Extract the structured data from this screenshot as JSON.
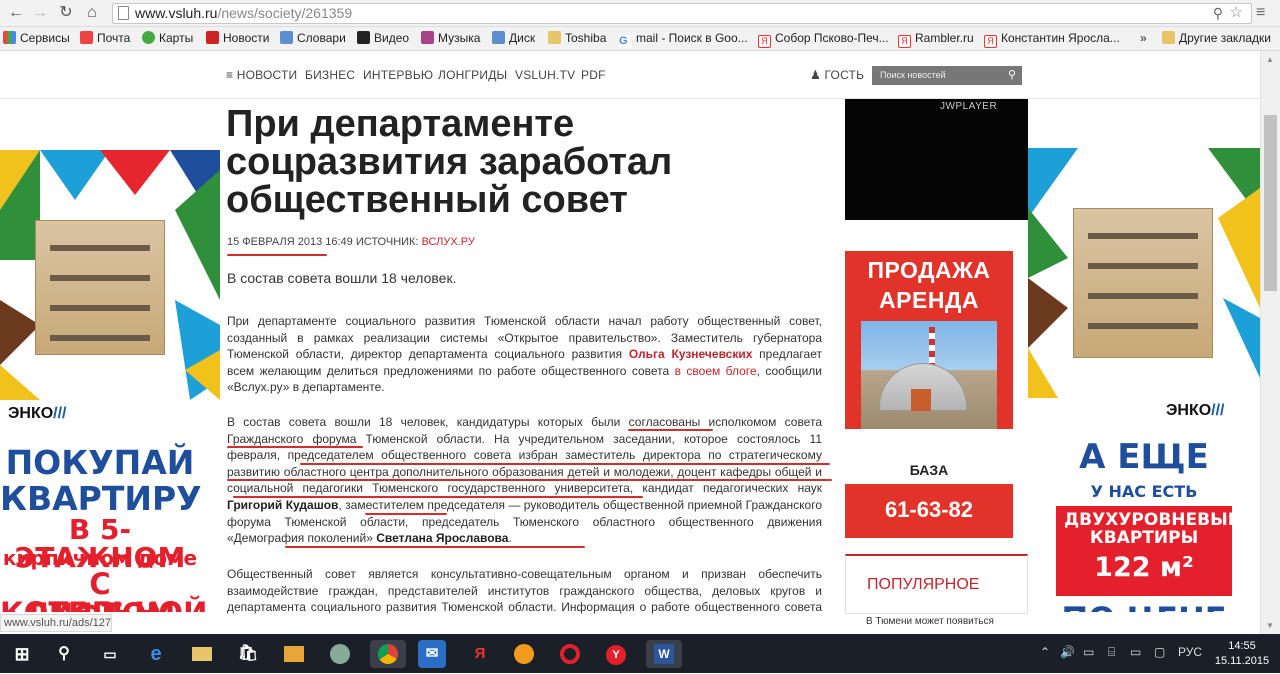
{
  "browser": {
    "url_domain": "www.vsluh.ru",
    "url_path": "/news/society/261359",
    "bookmarks": [
      "Сервисы",
      "Почта",
      "Карты",
      "Новости",
      "Словари",
      "Видео",
      "Музыка",
      "Диск",
      "Toshiba",
      "mail - Поиск в Goo...",
      "Собор Псково-Печ...",
      "Rambler.ru",
      "Константин Яросла...",
      "»",
      "Другие закладки"
    ]
  },
  "site_nav": {
    "items": [
      "НОВОСТИ",
      "БИЗНЕС",
      "ИНТЕРВЬЮ",
      "ЛОНГРИДЫ",
      "VSLUH.TV",
      "PDF"
    ],
    "guest": "ГОСТЬ",
    "search_placeholder": "Поиск новостей"
  },
  "article": {
    "title": "При департаменте соцразвития заработал общественный совет",
    "date": "15 ФЕВРАЛЯ 2013 16:49",
    "source_label": "ИСТОЧНИК:",
    "source": "ВСЛУХ.РУ",
    "lead": "В состав совета вошли 18 человек.",
    "p1": {
      "a": "При департаменте социального развития Тюменской области начал работу общественный совет, созданный в рамках реализации системы «Открытое правительство». Заместитель губернатора Тюменской области, директор департамента социального развития ",
      "name": "Ольга Кузнечевских",
      "b": " предлагает всем желающим делиться предложениями по работе общественного совета ",
      "link": "в своем блоге",
      "c": ", сообщили «Вслух.ру» в департаменте."
    },
    "p2": {
      "a": "В состав совета вошли 18 человек, кандидатуры которых были согласованы исполкомом совета Гражданского форума Тюменской области. На учредительном заседании, которое состоялось 11 февраля, председателем общественного совета избран заместитель директора по стратегическому развитию областного центра дополнительного образования детей и молодежи, доцент кафедры общей и социальной педагогики Тюменского государственного университета, кандидат педагогических наук ",
      "name1": "Григорий Кудашов",
      "b": ", заместителем председателя — руководитель общественной приемной Гражданского форума Тюменской области, председатель Тюменского областного общественного движения «Демография поколений» ",
      "name2": "Светлана Ярославова",
      "c": "."
    },
    "p3": "Общественный совет является консультативно-совещательным органом и призван обеспечить взаимодействие граждан, представителей институтов гражданского общества, деловых кругов и департамента социального развития Тюменской области. Информация о работе общественного совета размещается в разделе департамента социального развития Тюменской области"
  },
  "video": {
    "brand": "JWPLAYER"
  },
  "ad_mid": {
    "line1": "ПРОДАЖА",
    "line2": "АРЕНДА",
    "caption": "БАЗА",
    "phone": "61-63-82"
  },
  "popular": {
    "heading": "ПОПУЛЯРНОЕ",
    "item": "В Тюмени может появиться"
  },
  "ad_left": {
    "brand": "ЭНКО",
    "l1": "ПОКУПАЙ",
    "l2": "КВАРТИРУ",
    "l3": "В 5-ЭТАЖНОМ",
    "l4": "кирпичном доме",
    "l5": "С КОТЕЛЬНОЙ",
    "l6": "ЛИФТОМ ЗА"
  },
  "ad_right": {
    "brand": "ЭНКО",
    "l1": "А ЕЩЕ",
    "l2": "У НАС ЕСТЬ",
    "l3": "ДВУХУРОВНЕВЫЕ КВАРТИРЫ",
    "l4": "122 м²",
    "l5": "ПО ЦЕНЕ"
  },
  "status_url": "www.vsluh.ru/ads/127",
  "taskbar": {
    "lang": "РУС",
    "time": "14:55",
    "date": "15.11.2015"
  },
  "colors": {
    "accent": "#c0262d",
    "ad_blue": "#1f4f9c",
    "ad_red": "#e4202c"
  }
}
